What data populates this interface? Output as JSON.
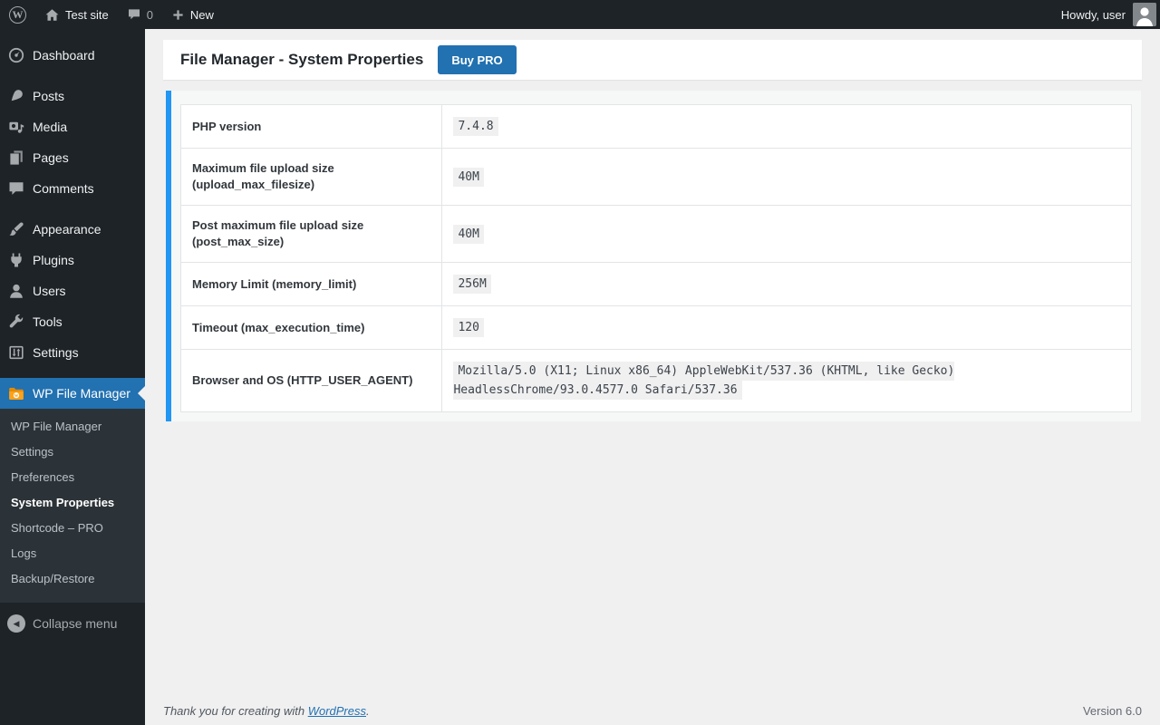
{
  "admin_bar": {
    "wp_logo_letter": "W",
    "site_name": "Test site",
    "comments_count": "0",
    "new_label": "New",
    "howdy_label": "Howdy, user"
  },
  "sidebar": {
    "items": [
      {
        "label": "Dashboard",
        "icon": "dashboard-icon",
        "separator_after": true
      },
      {
        "label": "Posts",
        "icon": "pushpin-icon"
      },
      {
        "label": "Media",
        "icon": "media-icon"
      },
      {
        "label": "Pages",
        "icon": "pages-icon"
      },
      {
        "label": "Comments",
        "icon": "comment-icon",
        "separator_after": true
      },
      {
        "label": "Appearance",
        "icon": "appearance-brush-icon"
      },
      {
        "label": "Plugins",
        "icon": "plugin-icon"
      },
      {
        "label": "Users",
        "icon": "user-icon"
      },
      {
        "label": "Tools",
        "icon": "wrench-icon"
      },
      {
        "label": "Settings",
        "icon": "settings-sliders-icon",
        "separator_after": true
      },
      {
        "label": "WP File Manager",
        "icon": "wp-file-manager-folder-icon",
        "active": true
      }
    ],
    "submenu_items": [
      {
        "label": "WP File Manager"
      },
      {
        "label": "Settings"
      },
      {
        "label": "Preferences"
      },
      {
        "label": "System Properties",
        "active": true
      },
      {
        "label": "Shortcode – PRO"
      },
      {
        "label": "Logs"
      },
      {
        "label": "Backup/Restore"
      }
    ],
    "collapse_label": "Collapse menu"
  },
  "main": {
    "page_title": "File Manager - System Properties",
    "buy_pro_label": "Buy PRO",
    "system_properties": [
      {
        "label": "PHP version",
        "value": "7.4.8"
      },
      {
        "label": "Maximum file upload size (upload_max_filesize)",
        "value": "40M"
      },
      {
        "label": "Post maximum file upload size (post_max_size)",
        "value": "40M"
      },
      {
        "label": "Memory Limit (memory_limit)",
        "value": "256M"
      },
      {
        "label": "Timeout (max_execution_time)",
        "value": "120"
      },
      {
        "label": "Browser and OS (HTTP_USER_AGENT)",
        "value": "Mozilla/5.0 (X11; Linux x86_64) AppleWebKit/537.36 (KHTML, like Gecko) HeadlessChrome/93.0.4577.0 Safari/537.36"
      }
    ]
  },
  "footer": {
    "thanks_prefix": "Thank you for creating with ",
    "wordpress_link_label": "WordPress",
    "thanks_suffix": ".",
    "version": "Version 6.0"
  },
  "colors": {
    "admin_dark": "#1d2327",
    "submenu_dark": "#2c3338",
    "active_blue": "#2271b1",
    "panel_accent_blue": "#2196f3",
    "content_background": "#f0f0f1"
  }
}
